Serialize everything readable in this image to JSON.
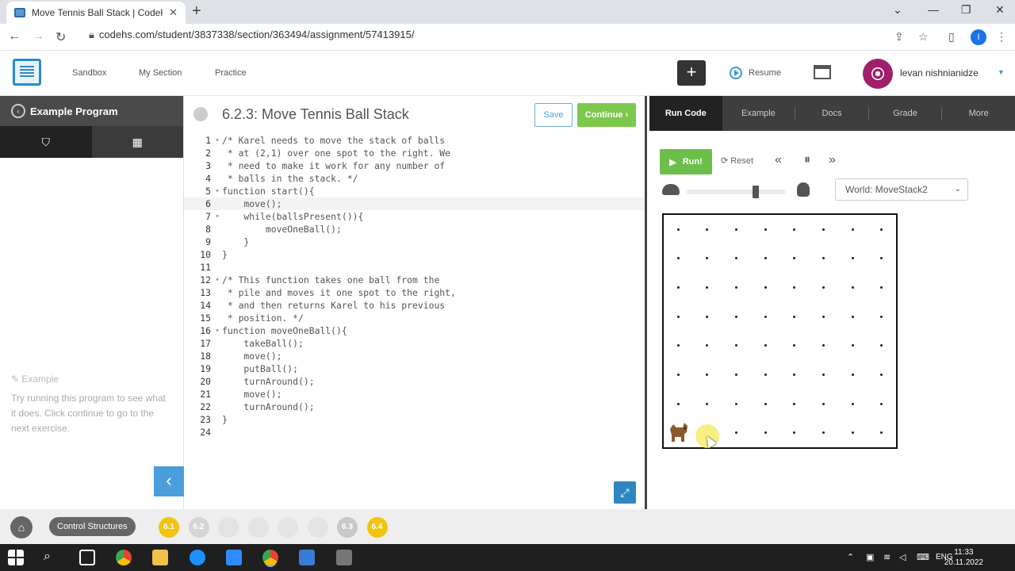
{
  "browser": {
    "tab_title": "Move Tennis Ball Stack | CodeHS",
    "url": "codehs.com/student/3837338/section/363494/assignment/57413915/",
    "profile_initial": "I"
  },
  "header": {
    "nav": [
      "Sandbox",
      "My Section",
      "Practice"
    ],
    "plus": "+",
    "resume": "Resume",
    "username": "levan nishnianidze"
  },
  "sidebar": {
    "title": "Example Program",
    "example_heading": "Example",
    "example_text": "Try running this program to see what it does. Click continue to go to the next exercise.",
    "collapse": "‹"
  },
  "editor": {
    "title": "6.2.3: Move Tennis Ball Stack",
    "save": "Save",
    "continue": "Continue ›",
    "expand": "⤢",
    "active_line": 6,
    "lines": [
      "/* Karel needs to move the stack of balls",
      " * at (2,1) over one spot to the right. We",
      " * need to make it work for any number of",
      " * balls in the stack. */",
      "function start(){",
      "    move();",
      "    while(ballsPresent()){",
      "        moveOneBall();",
      "    }",
      "}",
      "",
      "/* This function takes one ball from the",
      " * pile and moves it one spot to the right,",
      " * and then returns Karel to his previous",
      " * position. */",
      "function moveOneBall(){",
      "    takeBall();",
      "    move();",
      "    putBall();",
      "    turnAround();",
      "    move();",
      "    turnAround();",
      "}",
      ""
    ],
    "fold_lines": [
      1,
      5,
      7,
      12,
      16
    ]
  },
  "right_panel": {
    "tabs": [
      "Run Code",
      "Example",
      "Docs",
      "Grade",
      "More"
    ],
    "run": "Run!",
    "reset": "Reset",
    "speed_fraction": 0.8,
    "world_select": "World: MoveStack2",
    "grid_cols": 8,
    "grid_rows": 8
  },
  "bottom_bar": {
    "unit": "Control Structures",
    "crumbs": [
      {
        "label": "6.1",
        "color": "#f1c40f"
      },
      {
        "label": "6.2",
        "color": "#d5d5d5"
      },
      {
        "label": "",
        "color": "#e3e3e3"
      },
      {
        "label": "",
        "color": "#e3e3e3"
      },
      {
        "label": "",
        "color": "#e3e3e3"
      },
      {
        "label": "",
        "color": "#e3e3e3"
      },
      {
        "label": "6.3",
        "color": "#c8c8c8"
      },
      {
        "label": "6.4",
        "color": "#f1c40f"
      }
    ]
  },
  "taskbar": {
    "lang": "ENG",
    "time": "11:33",
    "date": "20.11.2022"
  }
}
